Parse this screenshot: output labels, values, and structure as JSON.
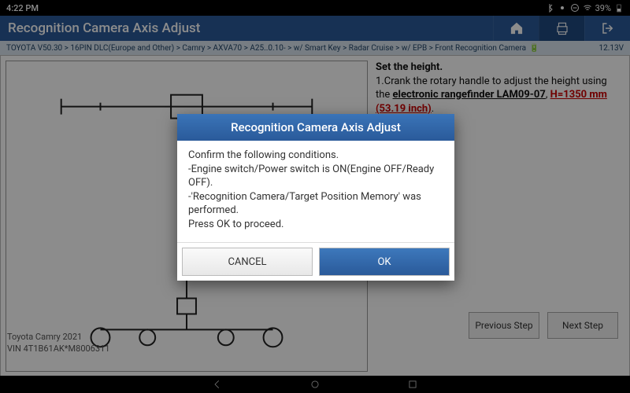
{
  "statusbar": {
    "time": "4:22 PM",
    "battery": "39%"
  },
  "appbar": {
    "title": "Recognition Camera Axis Adjust"
  },
  "breadcrumb": {
    "items": [
      "TOYOTA V50.30",
      "16PIN DLC(Europe and Other)",
      "Camry",
      "AXVA70",
      "A25..0.10-",
      "w/ Smart Key",
      "Radar Cruise",
      "w/ EPB",
      "Front Recognition Camera"
    ],
    "voltage": "12.13V"
  },
  "instructions": {
    "heading": "Set the height.",
    "line1_a": "1.Crank the rotary handle to adjust the height using the ",
    "line1_link": "electronic rangefinder LAM09-07",
    "line1_b": ", ",
    "line1_red": "H=1350 mm (53.19 inch)",
    "line1_c": "."
  },
  "nav": {
    "prev": "Previous Step",
    "next": "Next Step"
  },
  "footer": {
    "model": "Toyota Camry 2021",
    "vin": "VIN 4T1B61AK*M8006311"
  },
  "dialog": {
    "title": "Recognition Camera Axis Adjust",
    "body": "Confirm the following conditions.\n-Engine switch/Power switch is ON(Engine OFF/Ready OFF).\n-'Recognition Camera/Target Position Memory' was performed.\nPress OK to proceed.",
    "cancel": "CANCEL",
    "ok": "OK"
  }
}
